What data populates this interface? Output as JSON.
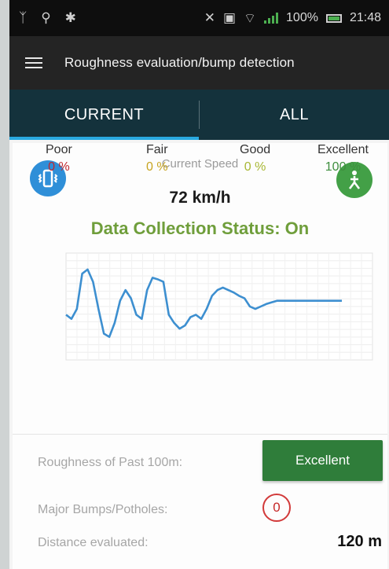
{
  "status_bar": {
    "battery": "100%",
    "time": "21:48",
    "icons": [
      "usb-icon",
      "debug-icon",
      "android-icon",
      "mute-icon",
      "sim-icon",
      "wifi-icon",
      "signal-icon",
      "battery-icon"
    ]
  },
  "app_bar": {
    "title": "Roughness evaluation/bump detection",
    "menu_icon": "hamburger-icon"
  },
  "tabs": [
    {
      "label": "CURRENT",
      "active": true
    },
    {
      "label": "ALL",
      "active": false
    }
  ],
  "speed": {
    "label": "Current Speed",
    "value": "72 km/h"
  },
  "status": {
    "text": "Data Collection Status: On",
    "color": "#6f9e3b"
  },
  "buttons": {
    "left_icon": "vibrate-icon",
    "right_icon": "navigation-icon"
  },
  "chart_data": {
    "type": "line",
    "series": [
      {
        "values": [
          0.55,
          0.5,
          0.62,
          1.05,
          1.1,
          0.95,
          0.62,
          0.32,
          0.28,
          0.45,
          0.72,
          0.85,
          0.75,
          0.55,
          0.5,
          0.85,
          1.0,
          0.98,
          0.95,
          0.55,
          0.45,
          0.38,
          0.42,
          0.52,
          0.55,
          0.5,
          0.62,
          0.78,
          0.85,
          0.88,
          0.85,
          0.82,
          0.78,
          0.75,
          0.65,
          0.62,
          0.65,
          0.68,
          0.7,
          0.72,
          0.72,
          0.72,
          0.72,
          0.72,
          0.72,
          0.72,
          0.72,
          0.72,
          0.72,
          0.72,
          0.72,
          0.72
        ],
        "color": "#3d8fd0"
      }
    ],
    "ylim": [
      0,
      1.3
    ],
    "grid": true
  },
  "ratings": [
    {
      "label": "Poor",
      "value": "0 %",
      "color": "#c0262d"
    },
    {
      "label": "Fair",
      "value": "0 %",
      "color": "#c7a420"
    },
    {
      "label": "Good",
      "value": "0 %",
      "color": "#a8b734"
    },
    {
      "label": "Excellent",
      "value": "100 %",
      "color": "#3e8e3e"
    }
  ],
  "roughness": {
    "label": "Roughness of Past 100m:",
    "value": "Excellent"
  },
  "bumps": {
    "label": "Major Bumps/Potholes:",
    "value": "0"
  },
  "distance": {
    "label": "Distance evaluated:",
    "value": "120 m"
  }
}
